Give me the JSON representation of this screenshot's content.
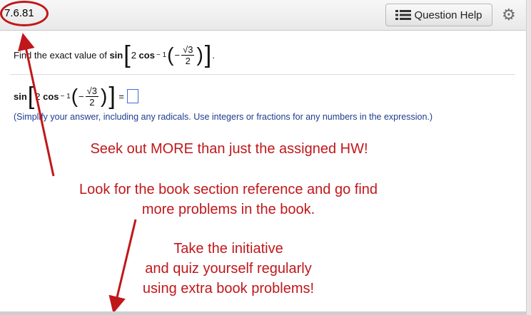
{
  "header": {
    "section_ref": "7.6.81",
    "help_label": "Question Help",
    "help_icon": "list-icon",
    "settings_icon": "gear-icon"
  },
  "question": {
    "prefix": "Find the exact value of",
    "func": "sin",
    "coef": "2",
    "inner_func": "cos",
    "exponent": "− 1",
    "sign": "−",
    "numerator": "√3",
    "denominator": "2",
    "period": "."
  },
  "answer": {
    "func": "sin",
    "equals": "="
  },
  "instructions": "(Simplify your answer, including any radicals.  Use integers or fractions for any numbers in the expression.)",
  "annotations": {
    "line1": "Seek out MORE than just the assigned HW!",
    "line2": "Look for the book section reference and go find",
    "line3": "more problems in the book.",
    "line4": "Take the initiative",
    "line5": "and quiz yourself regularly",
    "line6": "using extra book problems!"
  },
  "colors": {
    "annotation": "#c0171b",
    "instructions": "#1f3c8f",
    "answer_box": "#3b6fd6"
  }
}
